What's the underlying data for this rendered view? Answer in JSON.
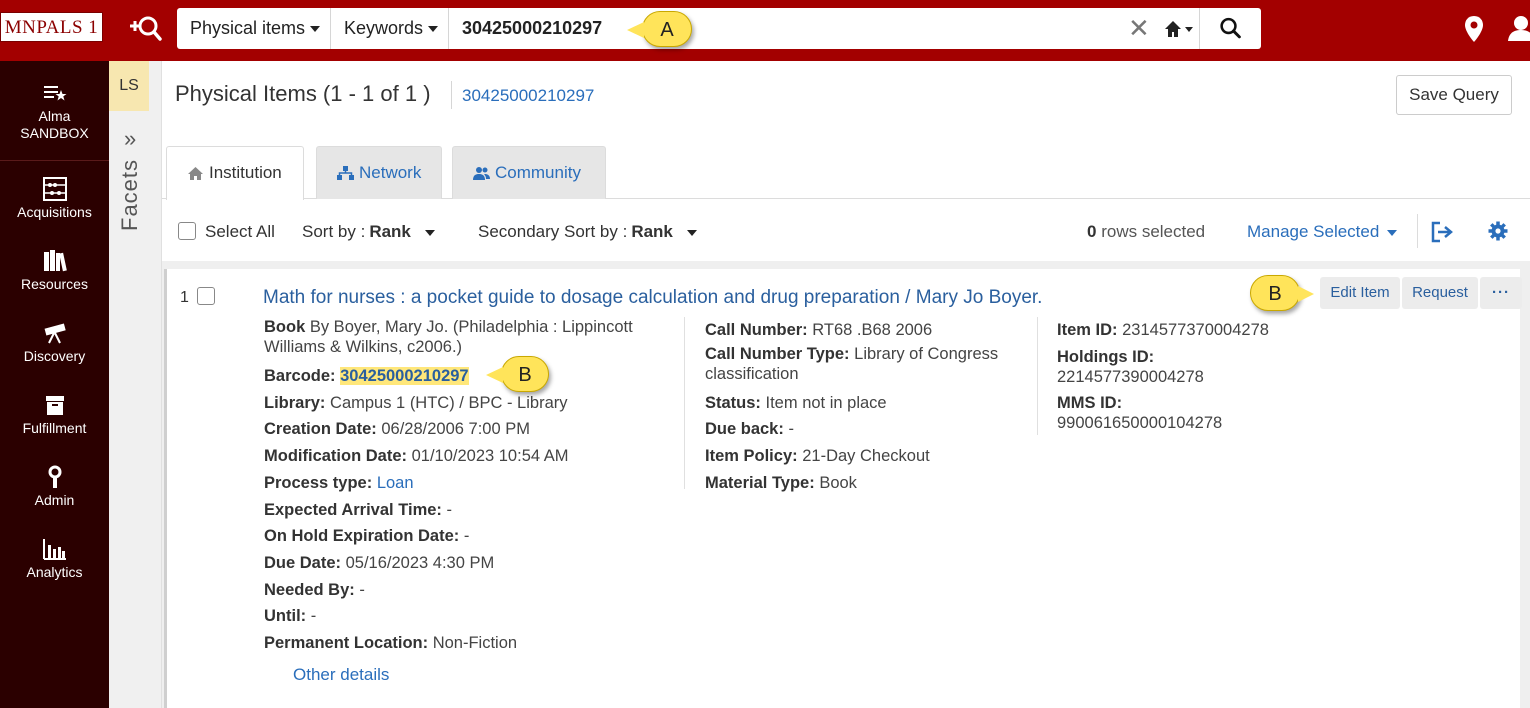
{
  "brand": {
    "logo_text": "MNPALS 1"
  },
  "search": {
    "scope_label": "Physical items",
    "field_label": "Keywords",
    "query": "30425000210297"
  },
  "callouts": {
    "a": "A",
    "b_barcode": "B",
    "b_edit": "B"
  },
  "leftnav": [
    {
      "label_line1": "Alma",
      "label_line2": "SANDBOX",
      "icon": "alma-menu-icon"
    },
    {
      "label": "Acquisitions",
      "icon": "abacus-icon"
    },
    {
      "label": "Resources",
      "icon": "books-icon"
    },
    {
      "label": "Discovery",
      "icon": "telescope-icon"
    },
    {
      "label": "Fulfillment",
      "icon": "archive-box-icon"
    },
    {
      "label": "Admin",
      "icon": "wrench-icon"
    },
    {
      "label": "Analytics",
      "icon": "bar-chart-icon"
    }
  ],
  "facets": {
    "ls_label": "LS",
    "label": "Facets"
  },
  "header": {
    "title": "Physical Items (1 - 1 of 1 )",
    "query_link": "30425000210297",
    "save_query": "Save Query"
  },
  "tabs": [
    {
      "label": "Institution",
      "icon": "home-icon"
    },
    {
      "label": "Network",
      "icon": "network-icon"
    },
    {
      "label": "Community",
      "icon": "people-icon"
    }
  ],
  "toolbar": {
    "select_all": "Select All",
    "sort_by_label": "Sort by :",
    "sort_by_value": "Rank",
    "secondary_sort_label": "Secondary Sort by :",
    "secondary_sort_value": "Rank",
    "rows_selected_count": "0",
    "rows_selected_text": "rows selected",
    "manage_selected": "Manage Selected"
  },
  "result": {
    "row_number": "1",
    "title": "Math for nurses : a pocket guide to dosage calculation and drug preparation / Mary Jo Boyer.",
    "actions": {
      "edit": "Edit Item",
      "request": "Request",
      "more": "···"
    },
    "col1": {
      "type_label": "Book",
      "type_value": "By Boyer, Mary Jo. (Philadelphia : Lippincott Williams & Wilkins, c2006.)",
      "barcode_label": "Barcode:",
      "barcode_value": "30425000210297",
      "library_label": "Library:",
      "library_value": "Campus 1 (HTC) / BPC - Library",
      "creation_label": "Creation Date:",
      "creation_value": "06/28/2006 7:00 PM",
      "modification_label": "Modification Date:",
      "modification_value": "01/10/2023 10:54 AM",
      "process_label": "Process type:",
      "process_value": "Loan",
      "arrival_label": "Expected Arrival Time:",
      "arrival_value": "-",
      "onhold_label": "On Hold Expiration Date:",
      "onhold_value": "-",
      "due_label": "Due Date:",
      "due_value": "05/16/2023 4:30 PM",
      "needed_label": "Needed By:",
      "needed_value": "-",
      "until_label": "Until:",
      "until_value": "-",
      "location_label": "Permanent Location:",
      "location_value": "Non-Fiction"
    },
    "col2": {
      "callno_label": "Call Number:",
      "callno_value": "RT68 .B68 2006",
      "callno_type_label": "Call Number Type:",
      "callno_type_value": "Library of Congress classification",
      "status_label": "Status:",
      "status_value": "Item not in place",
      "dueback_label": "Due back:",
      "dueback_value": "-",
      "policy_label": "Item Policy:",
      "policy_value": "21-Day Checkout",
      "material_label": "Material Type:",
      "material_value": "Book"
    },
    "col3": {
      "item_id_label": "Item ID:",
      "item_id_value": "2314577370004278",
      "holdings_label": "Holdings ID:",
      "holdings_value": "2214577390004278",
      "mms_label": "MMS ID:",
      "mms_value": "990061650000104278"
    },
    "other_details": "Other details"
  },
  "colors": {
    "topbar": "#a30000",
    "leftnav": "#2b0000",
    "link": "#2a6ebb",
    "highlight": "#ffe77a"
  }
}
